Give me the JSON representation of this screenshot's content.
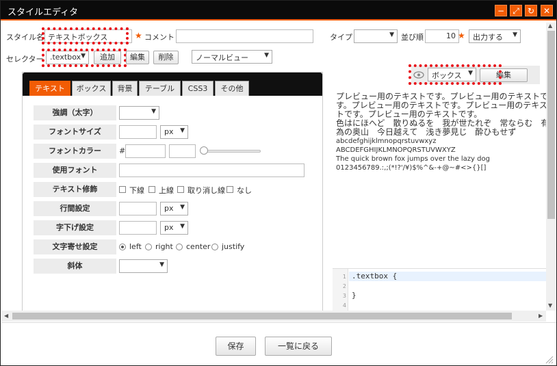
{
  "window": {
    "title": "スタイルエディタ",
    "minimize": "−",
    "maximize": "⤢",
    "refresh": "↻",
    "close": "✕"
  },
  "header": {
    "style_name_label": "スタイル名",
    "style_name_value": "テキストボックス",
    "comment_label": "コメント",
    "comment_value": "",
    "type_label": "タイプ",
    "type_value": "",
    "order_label": "並び順",
    "order_value": "10",
    "output_value": "出力する",
    "selector_label": "セレクター",
    "selector_value": ".textbox",
    "add_label": "追加",
    "edit_label": "編集",
    "delete_label": "削除",
    "view_value": "ノーマルビュー",
    "preview_type_value": "ボックス",
    "preview_edit_label": "編集",
    "required_mark": "★",
    "dropdown_arrow": "▼"
  },
  "tabs": [
    {
      "label": "テキスト",
      "active": true
    },
    {
      "label": "ボックス",
      "active": false
    },
    {
      "label": "背景",
      "active": false
    },
    {
      "label": "テーブル",
      "active": false
    },
    {
      "label": "CSS3",
      "active": false
    },
    {
      "label": "その他",
      "active": false
    }
  ],
  "form": {
    "bold_label": "強調（太字）",
    "font_size_label": "フォントサイズ",
    "font_color_label": "フォントカラー",
    "font_family_label": "使用フォント",
    "decoration_label": "テキスト修飾",
    "line_height_label": "行間設定",
    "indent_label": "字下げ設定",
    "align_label": "文字寄せ設定",
    "italic_label": "斜体",
    "unit_px": "px",
    "hash": "#",
    "decoration_options": [
      "下線",
      "上線",
      "取り消し線",
      "なし"
    ],
    "align_options": [
      "left",
      "right",
      "center",
      "justify"
    ],
    "align_selected": "left"
  },
  "preview": {
    "lines": [
      "プレビュー用のテキストです。プレビュー用のテキストで",
      "す。プレビュー用のテキストです。プレビュー用のテキス",
      "トです。プレビュー用のテキストです。",
      "色はにほへど　散りぬるを　我が世たれぞ　常ならむ　有",
      "為の奥山　今日越えて　浅き夢見じ　酔ひもせず",
      "abcdefghijklmnopqrstuvwxyz",
      "ABCDEFGHIJKLMNOPQRSTUVWXYZ",
      "The quick brown fox jumps over the lazy dog",
      "0123456789.:,;(*!?'/¥)$%^&-+@~#<>{}[]"
    ]
  },
  "code": {
    "lines": [
      {
        "num": "1",
        "text": ".textbox {"
      },
      {
        "num": "2",
        "text": ""
      },
      {
        "num": "3",
        "text": "}"
      },
      {
        "num": "4",
        "text": ""
      }
    ]
  },
  "footer": {
    "save_label": "保存",
    "back_label": "一覧に戻る"
  },
  "colors": {
    "accent": "#f25c05",
    "highlight": "#e8131a",
    "titlebar": "#0b0b0b"
  }
}
